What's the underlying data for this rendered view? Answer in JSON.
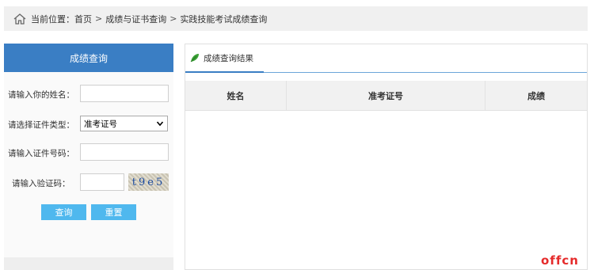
{
  "breadcrumb": {
    "prefix": "当前位置：",
    "home": "首页",
    "sep": ">",
    "section": "成绩与证书查询",
    "current": "实践技能考试成绩查询"
  },
  "sidebar": {
    "title": "成绩查询",
    "name_label": "请输入你的姓名：",
    "name_value": "",
    "id_type_label": "请选择证件类型：",
    "id_type_selected": "准考证号",
    "id_number_label": "请输入证件号码：",
    "id_number_value": "",
    "captcha_label": "请输入验证码：",
    "captcha_value": "",
    "captcha_text": "t9e5",
    "query_button": "查询",
    "reset_button": "重置"
  },
  "results": {
    "tab_label": "成绩查询结果",
    "columns": [
      "姓名",
      "准考证号",
      "成绩"
    ]
  },
  "watermark": "offcn",
  "colors": {
    "accent_blue": "#3a7ec4",
    "button_blue": "#4fb8ee",
    "watermark_red": "#e52b2b",
    "leaf_green": "#3aa035"
  },
  "icons": {
    "home": "home-icon",
    "leaf": "leaf-icon",
    "dropdown": "chevron-down-icon"
  }
}
